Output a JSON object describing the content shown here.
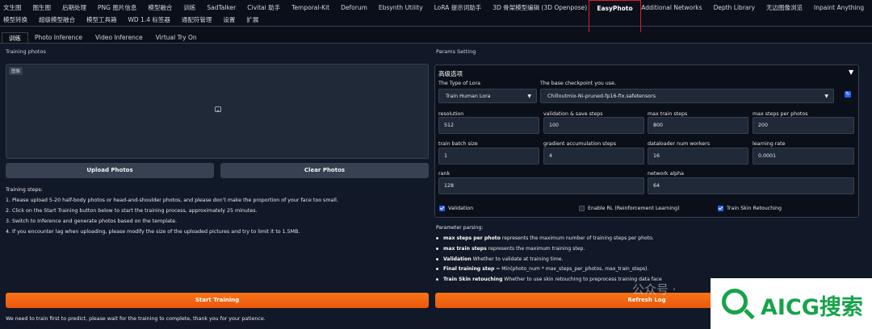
{
  "top_tabs_row1": [
    "文生图",
    "图生图",
    "后期处理",
    "PNG 图片信息",
    "模型融合",
    "训练",
    "SadTalker",
    "Civitai 助手",
    "Temporal-Kit",
    "Deforum",
    "Ebsynth Utility",
    "LoRA 提示词助手",
    "3D 骨架模型编辑 (3D Openpose)",
    "EasyPhoto",
    "Additional Networks",
    "Depth Library",
    "无边图像浏览",
    "Inpaint Anything"
  ],
  "top_tabs_row2": [
    "模型转换",
    "超级模型融合",
    "模型工具箱",
    "WD 1.4 标签器",
    "通配符管理",
    "设置",
    "扩展"
  ],
  "active_top_tab": "EasyPhoto",
  "sub_tabs": [
    "训练",
    "Photo Inference",
    "Video Inference",
    "Virtual Try On"
  ],
  "left": {
    "training_photos_label": "Training photos",
    "image_badge": "图像",
    "upload_button": "Upload Photos",
    "clear_button": "Clear Photos",
    "steps_title": "Training steps:",
    "steps": [
      "1. Please upload 5-20 half-body photos or head-and-shoulder photos, and please don't make the proportion of your face too small.",
      "2. Click on the Start Training button below to start the training process, approximately 25 minutes.",
      "3. Switch to Inference and generate photos based on the template.",
      "4. If you encounter lag when uploading, please modify the size of the uploaded pictures and try to limit it to 1.5MB."
    ],
    "start_button": "Start Training",
    "footer_note": "We need to train first to predict, please wait for the training to complete, thank you for your patience."
  },
  "right": {
    "params_label": "Params Setting",
    "advanced_title": "高级选项",
    "lora_type_label": "The Type of Lora",
    "lora_type_value": "Train Human Lora",
    "checkpoint_label": "The base checkpoint you use.",
    "checkpoint_value": "Chilloutmix-Ni-pruned-fp16-fix.safetensors",
    "fields": {
      "resolution": {
        "label": "resolution",
        "value": "512"
      },
      "val_steps": {
        "label": "validation & save steps",
        "value": "100"
      },
      "max_train_steps": {
        "label": "max train steps",
        "value": "800"
      },
      "max_steps_per_photo": {
        "label": "max steps per photos",
        "value": "200"
      },
      "batch_size": {
        "label": "train batch size",
        "value": "1"
      },
      "grad_accum": {
        "label": "gradient accumulation steps",
        "value": "4"
      },
      "num_workers": {
        "label": "dataloader num workers",
        "value": "16"
      },
      "lr": {
        "label": "learning rate",
        "value": "0.0001"
      },
      "rank": {
        "label": "rank",
        "value": "128"
      },
      "alpha": {
        "label": "network alpha",
        "value": "64"
      }
    },
    "checkbox_validation": {
      "label": "Validation",
      "checked": true
    },
    "checkbox_rl": {
      "label": "Enable RL (Reinforcement Learning)",
      "checked": false
    },
    "checkbox_skin": {
      "label": "Train Skin Retouching",
      "checked": true
    },
    "parsing_title": "Parameter parsing:",
    "parsing": [
      {
        "bold": "max steps per photo",
        "text": " represents the maximum number of training steps per photo."
      },
      {
        "bold": "max train steps",
        "text": " represents the maximum training step."
      },
      {
        "bold": "Validation",
        "text": " Whether to validate at training time."
      },
      {
        "bold": "Final training step",
        "text": " = Min(photo_num * max_steps_per_photos, max_train_steps)."
      },
      {
        "bold": "Train Skin retouching",
        "text": " Whether to use skin retouching to preprocess training data face"
      }
    ],
    "refresh_button": "Refresh Log"
  },
  "watermark": {
    "wechat": "公众号 ·",
    "logo": "AICG搜索"
  },
  "colors": {
    "accent": "#ea580c",
    "checkbox": "#2563eb",
    "logo_green": "#16a34a",
    "active_tab_border": "#e11d2a"
  }
}
